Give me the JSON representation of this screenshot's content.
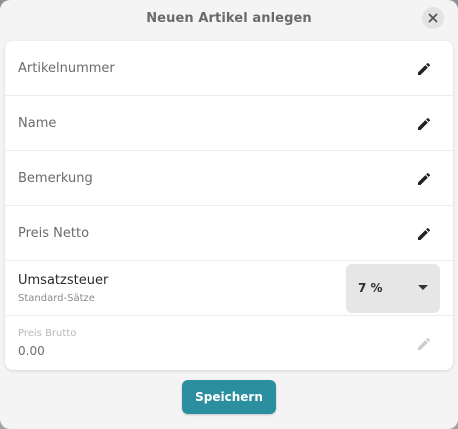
{
  "dialog": {
    "title": "Neuen Artikel anlegen",
    "close_icon": "close-icon"
  },
  "fields": {
    "artikelnummer": {
      "label": "Artikelnummer",
      "icon": "pencil-icon"
    },
    "name": {
      "label": "Name",
      "icon": "pencil-icon"
    },
    "bemerkung": {
      "label": "Bemerkung",
      "icon": "pencil-icon"
    },
    "preis_netto": {
      "label": "Preis Netto",
      "icon": "pencil-icon"
    },
    "umsatzsteuer": {
      "label": "Umsatzsteuer",
      "sublabel": "Standard-Sätze",
      "selected": "7 %",
      "icon": "caret-down-icon"
    },
    "preis_brutto": {
      "label": "Preis Brutto",
      "value": "0.00",
      "icon": "pencil-icon",
      "disabled": true
    }
  },
  "footer": {
    "save_label": "Speichern"
  },
  "colors": {
    "accent": "#2b8fa0",
    "icon_active": "#222222",
    "icon_disabled": "#cccccc"
  }
}
